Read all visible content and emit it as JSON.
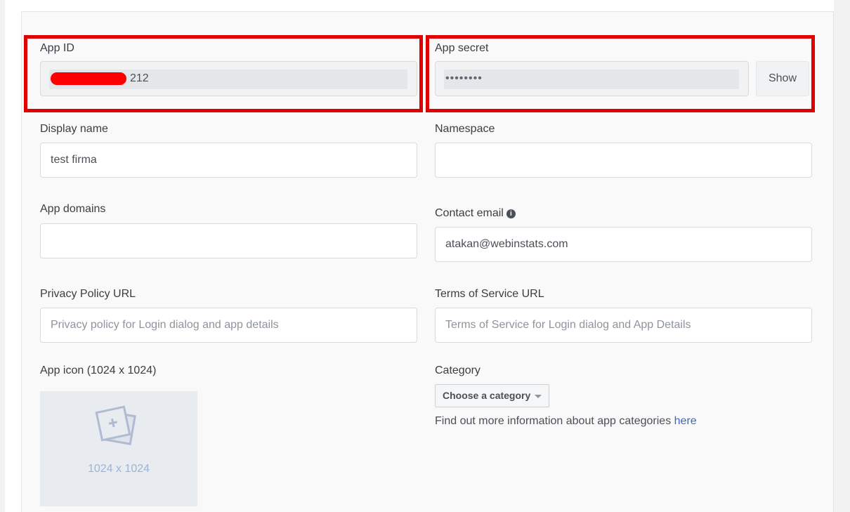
{
  "app_id": {
    "label": "App ID",
    "value_suffix": "212"
  },
  "app_secret": {
    "label": "App secret",
    "masked_value": "••••••••",
    "show_button": "Show"
  },
  "display_name": {
    "label": "Display name",
    "value": "test firma"
  },
  "namespace": {
    "label": "Namespace",
    "value": ""
  },
  "app_domains": {
    "label": "App domains",
    "value": ""
  },
  "contact_email": {
    "label": "Contact email",
    "value": "atakan@webinstats.com",
    "info_icon": "info-icon"
  },
  "privacy_policy": {
    "label": "Privacy Policy URL",
    "placeholder": "Privacy policy for Login dialog and app details"
  },
  "terms_of_service": {
    "label": "Terms of Service URL",
    "placeholder": "Terms of Service for Login dialog and App Details"
  },
  "app_icon": {
    "label": "App icon (1024 x 1024)",
    "caption": "1024 x 1024",
    "icon": "image-add-icon"
  },
  "category": {
    "label": "Category",
    "select_label": "Choose a category",
    "info_text": "Find out more information about app categories ",
    "info_link": "here"
  },
  "colors": {
    "highlight_frame": "#e00000",
    "link": "#4267b2"
  }
}
